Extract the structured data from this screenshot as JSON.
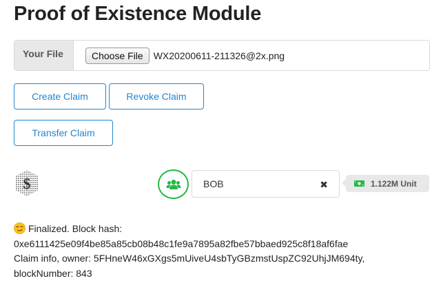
{
  "title": "Proof of Existence Module",
  "file_upload": {
    "label": "Your File",
    "button_label": "Choose File",
    "file_name": "WX20200611-211326@2x.png"
  },
  "actions": {
    "create": "Create Claim",
    "revoke": "Revoke Claim",
    "transfer": "Transfer Claim"
  },
  "account": {
    "address_value": "BOB",
    "clear_icon": "close-icon",
    "balance": "1.122M Unit",
    "users_icon": "users-icon",
    "money_icon": "money-icon"
  },
  "status": {
    "emoji": "smirk-emoji",
    "line1": "Finalized. Block hash:",
    "line2": "0xe6111425e09f4be85a85cb08b48c1fe9a7895a82fbe57bbaed925c8f18af6fae",
    "line3": "Claim info, owner: 5FHneW46xGXgs5mUiveU4sbTyGBzmstUspZC92UhjJM694ty,",
    "line4": "blockNumber: 843"
  },
  "colors": {
    "primary_blue": "#2185d0",
    "green": "#21ba45",
    "label_bg": "#e8e8e8"
  }
}
